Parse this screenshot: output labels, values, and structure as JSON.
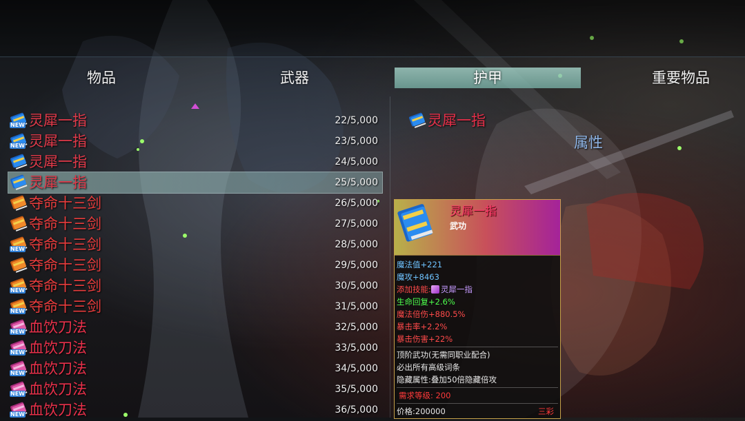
{
  "tabs": [
    {
      "label": "物品",
      "active": false
    },
    {
      "label": "武器",
      "active": false
    },
    {
      "label": "护甲",
      "active": true
    },
    {
      "label": "重要物品",
      "active": false
    }
  ],
  "items": [
    {
      "name": "灵犀一指",
      "qty": "22/5,000",
      "icon": "blue-book-icon",
      "new": true,
      "selected": false
    },
    {
      "name": "灵犀一指",
      "qty": "23/5,000",
      "icon": "blue-book-icon",
      "new": true,
      "selected": false
    },
    {
      "name": "灵犀一指",
      "qty": "24/5,000",
      "icon": "blue-book-icon",
      "new": false,
      "selected": false
    },
    {
      "name": "灵犀一指",
      "qty": "25/5,000",
      "icon": "blue-book-icon",
      "new": false,
      "selected": true
    },
    {
      "name": "夺命十三剑",
      "qty": "26/5,000",
      "icon": "orange-book-icon",
      "new": false,
      "selected": false
    },
    {
      "name": "夺命十三剑",
      "qty": "27/5,000",
      "icon": "orange-book-icon",
      "new": false,
      "selected": false
    },
    {
      "name": "夺命十三剑",
      "qty": "28/5,000",
      "icon": "orange-book-icon",
      "new": true,
      "selected": false
    },
    {
      "name": "夺命十三剑",
      "qty": "29/5,000",
      "icon": "orange-book-icon",
      "new": false,
      "selected": false
    },
    {
      "name": "夺命十三剑",
      "qty": "30/5,000",
      "icon": "orange-book-icon",
      "new": true,
      "selected": false
    },
    {
      "name": "夺命十三剑",
      "qty": "31/5,000",
      "icon": "orange-book-icon",
      "new": true,
      "selected": false
    },
    {
      "name": "血饮刀法",
      "qty": "32/5,000",
      "icon": "pink-book-icon",
      "new": true,
      "selected": false
    },
    {
      "name": "血饮刀法",
      "qty": "33/5,000",
      "icon": "pink-book-icon",
      "new": true,
      "selected": false
    },
    {
      "name": "血饮刀法",
      "qty": "34/5,000",
      "icon": "pink-book-icon",
      "new": true,
      "selected": false
    },
    {
      "name": "血饮刀法",
      "qty": "35/5,000",
      "icon": "pink-book-icon",
      "new": true,
      "selected": false
    },
    {
      "name": "血饮刀法",
      "qty": "36/5,000",
      "icon": "pink-book-icon",
      "new": true,
      "selected": false
    }
  ],
  "new_label": "NEW",
  "detail": {
    "name": "灵犀一指",
    "attr_heading": "属性"
  },
  "panel": {
    "name": "灵犀一指",
    "type": "武功",
    "stats": [
      {
        "text": "魔法值+221",
        "color": "#6fc3ff"
      },
      {
        "text": "魔攻+8463",
        "color": "#6fc3ff"
      },
      {
        "text": "添加技能:",
        "color": "#ff4a4a",
        "skill": "灵犀一指",
        "skill_color": "#c69bff"
      },
      {
        "text": "生命回复+2.6%",
        "color": "#4dff4d"
      },
      {
        "text": "魔法倍伤+880.5%",
        "color": "#ff4a4a"
      },
      {
        "text": "暴击率+2.2%",
        "color": "#ff4a4a"
      },
      {
        "text": "暴击伤害+22%",
        "color": "#ff4a4a"
      }
    ],
    "notes": [
      "顶阶武功(无需同职业配合)",
      "必出所有高级词条",
      "隐藏属性:叠加50倍隐藏倍攻"
    ],
    "notes_color": "#e8e8e8",
    "req_level": "需求等级: 200",
    "req_color": "#ff3a3a",
    "price": "价格:200000",
    "rarity": "三彩",
    "rarity_color": "#ff3a3a"
  },
  "colors": {
    "blue_book": "#e23a4a",
    "orange_book": "#e83c3c",
    "pink_book": "#e8304a",
    "selected_name": "#e8304a",
    "tab_active_bg": "#a0cdc3"
  }
}
